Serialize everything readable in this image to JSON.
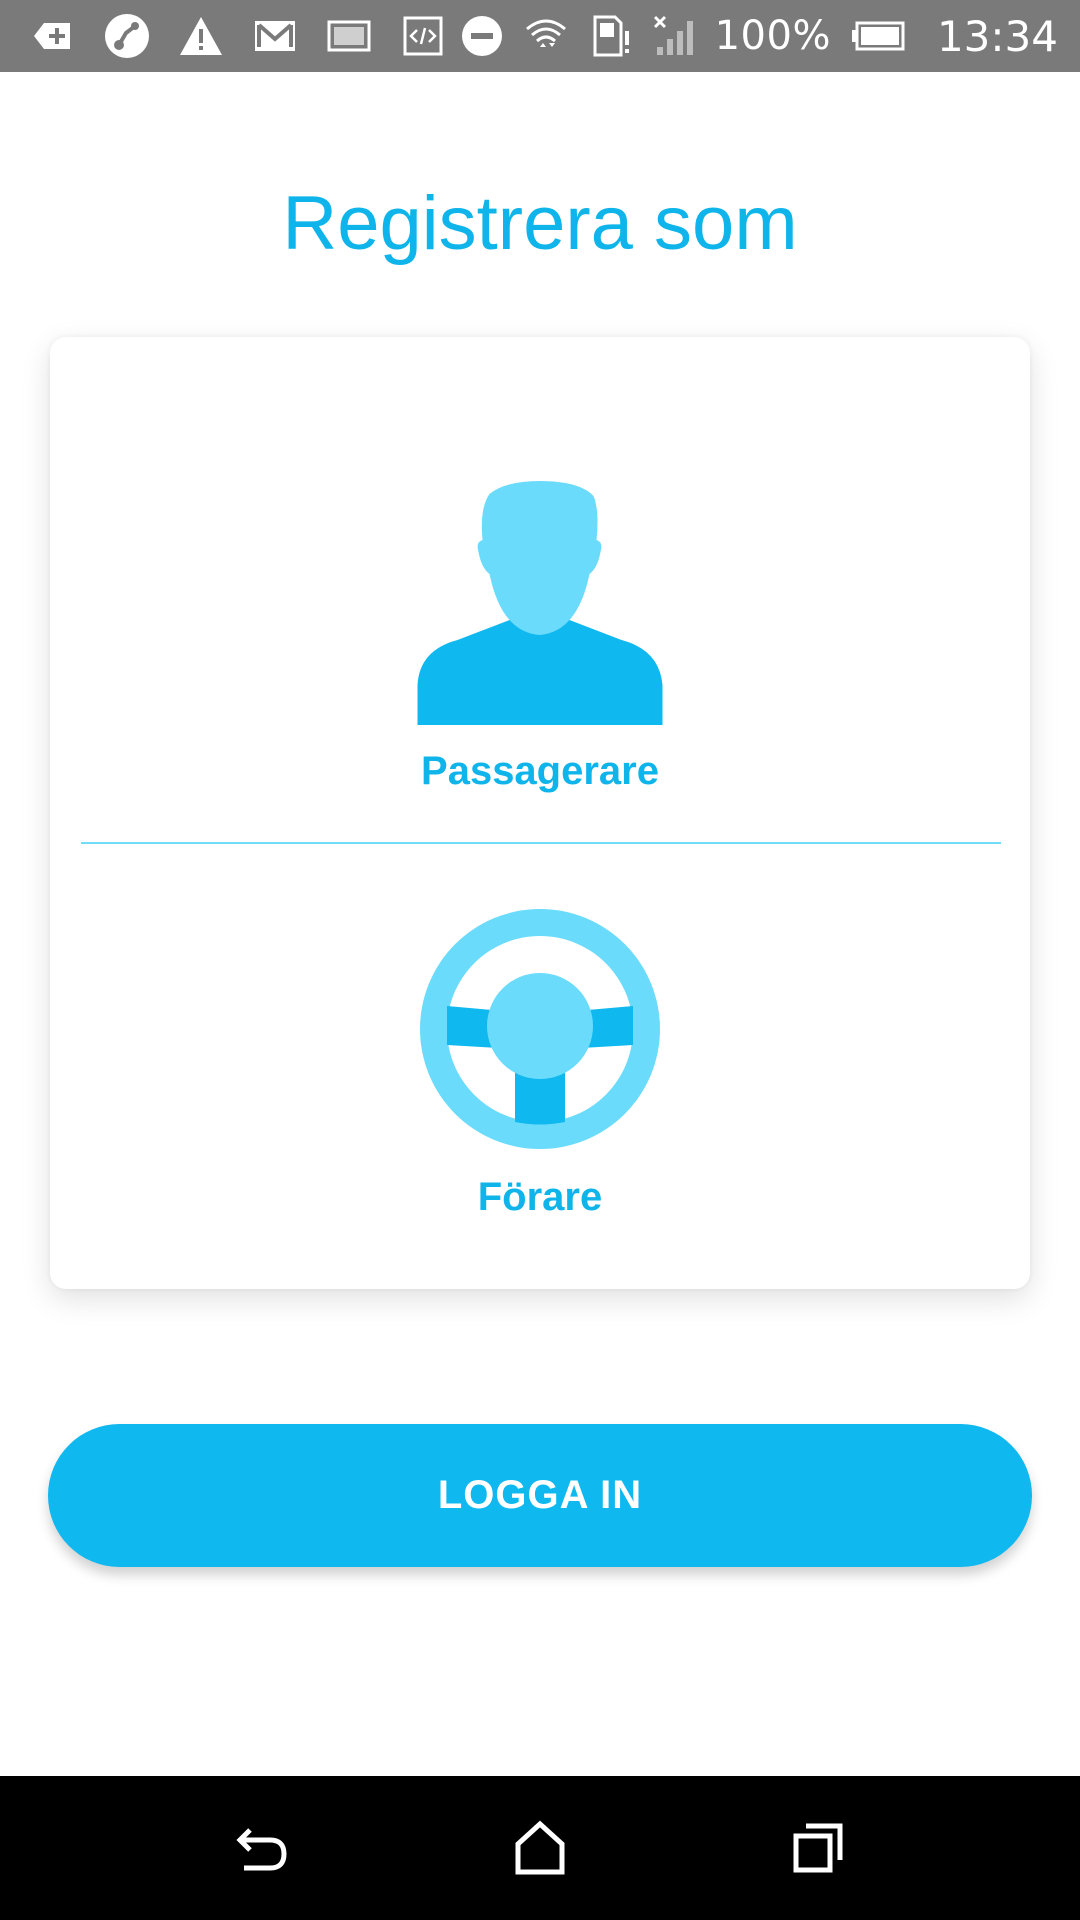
{
  "status_bar": {
    "battery_percent": "100%",
    "time": "13:34",
    "icons": [
      "add-box-icon",
      "route-icon",
      "warning-icon",
      "gmail-icon",
      "image-icon",
      "code-icon",
      "do-not-disturb-icon",
      "wifi-icon",
      "sim-alert-icon",
      "no-signal-icon",
      "battery-icon"
    ]
  },
  "page": {
    "title": "Registrera som"
  },
  "options": {
    "passenger_label": "Passagerare",
    "driver_label": "Förare"
  },
  "login": {
    "label": "LOGGA IN"
  },
  "colors": {
    "accent": "#0fb5ea",
    "icon_light": "#6bdbfb",
    "divider": "#70dcf7",
    "button": "#0fb8ef",
    "status_bar": "#7a7a7a",
    "nav_bar": "#000000"
  },
  "nav_bar": {
    "icons": [
      "back-icon",
      "home-icon",
      "recents-icon"
    ]
  }
}
